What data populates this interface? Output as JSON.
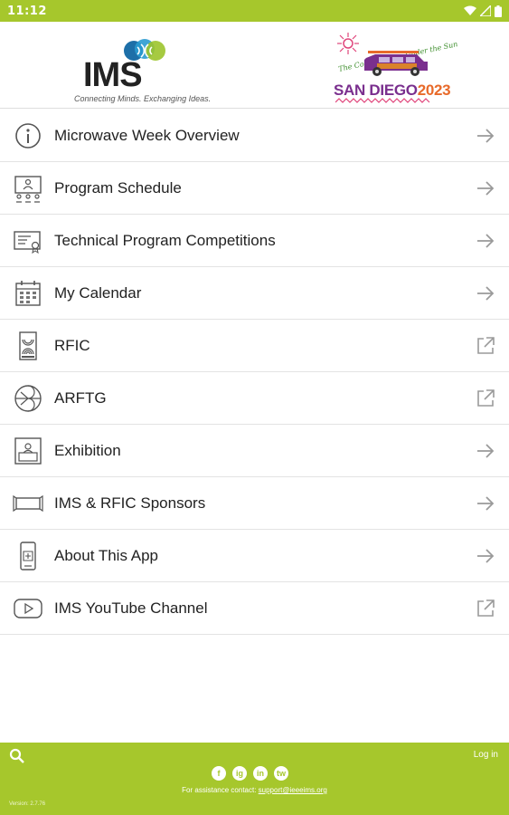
{
  "status_bar": {
    "time": "11:12"
  },
  "header": {
    "ims_logo": {
      "word": "IMS",
      "tagline": "Connecting Minds. Exchanging Ideas."
    },
    "event_logo": {
      "script": "The Coolest Ideas Under the Sun",
      "city": "SAN DIEGO",
      "year": "2023"
    }
  },
  "menu": {
    "items": [
      {
        "label": "Microwave Week Overview",
        "icon": "info-icon",
        "trail": "arrow"
      },
      {
        "label": "Program Schedule",
        "icon": "presentation-icon",
        "trail": "arrow"
      },
      {
        "label": "Technical Program Competitions",
        "icon": "certificate-icon",
        "trail": "arrow"
      },
      {
        "label": "My Calendar",
        "icon": "calendar-icon",
        "trail": "arrow"
      },
      {
        "label": "RFIC",
        "icon": "rfic-device-icon",
        "trail": "external"
      },
      {
        "label": "ARFTG",
        "icon": "arftg-icon",
        "trail": "external"
      },
      {
        "label": "Exhibition",
        "icon": "exhibition-booth-icon",
        "trail": "arrow"
      },
      {
        "label": "IMS & RFIC Sponsors",
        "icon": "sponsor-banner-icon",
        "trail": "arrow"
      },
      {
        "label": "About This App",
        "icon": "mobile-app-icon",
        "trail": "arrow"
      },
      {
        "label": "IMS YouTube Channel",
        "icon": "youtube-icon",
        "trail": "external"
      }
    ]
  },
  "footer": {
    "login_label": "Log in",
    "assist_text": "For assistance contact: ",
    "assist_email": "support@ieeeims.org",
    "version": "Version: 2.7.76",
    "socials": [
      "f",
      "ig",
      "in",
      "tw"
    ]
  },
  "colors": {
    "accent": "#a6c72c",
    "divider": "#e3e3e3",
    "icon": "#555555"
  }
}
